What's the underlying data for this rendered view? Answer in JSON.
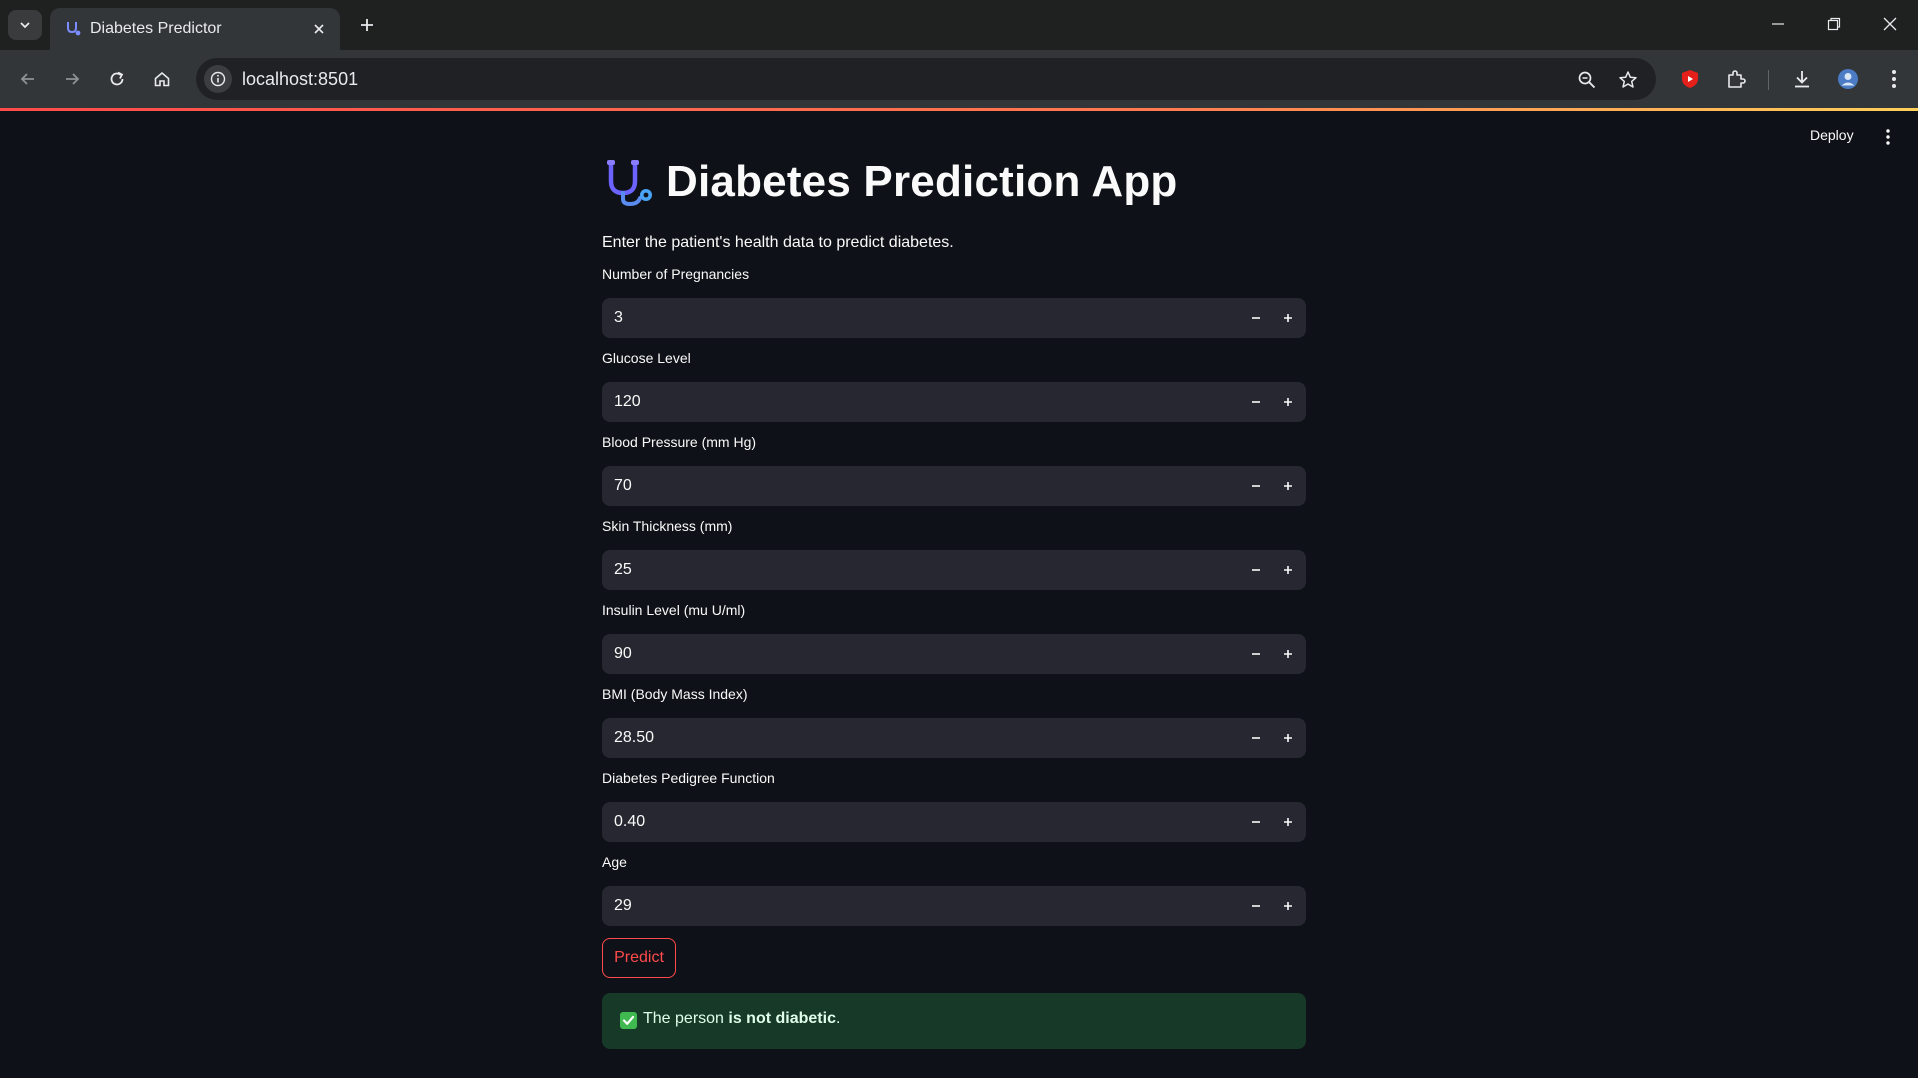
{
  "browser": {
    "tab_title": "Diabetes Predictor",
    "url": "localhost:8501"
  },
  "app": {
    "deploy_label": "Deploy",
    "title": "Diabetes Prediction App",
    "subtitle": "Enter the patient's health data to predict diabetes.",
    "fields": [
      {
        "label": "Number of Pregnancies",
        "value": "3"
      },
      {
        "label": "Glucose Level",
        "value": "120"
      },
      {
        "label": "Blood Pressure (mm Hg)",
        "value": "70"
      },
      {
        "label": "Skin Thickness (mm)",
        "value": "25"
      },
      {
        "label": "Insulin Level (mu U/ml)",
        "value": "90"
      },
      {
        "label": "BMI (Body Mass Index)",
        "value": "28.50"
      },
      {
        "label": "Diabetes Pedigree Function",
        "value": "0.40"
      },
      {
        "label": "Age",
        "value": "29"
      }
    ],
    "predict_label": "Predict",
    "result": {
      "prefix": "The person ",
      "emphasis": "is not diabetic",
      "suffix": "."
    }
  },
  "colors": {
    "accent": "#ff4b4b",
    "background": "#0e1117",
    "input_bg": "#262730",
    "success_bg": "#173928"
  },
  "icons": {
    "title": "stethoscope-icon",
    "result": "check-mark-button-icon"
  }
}
